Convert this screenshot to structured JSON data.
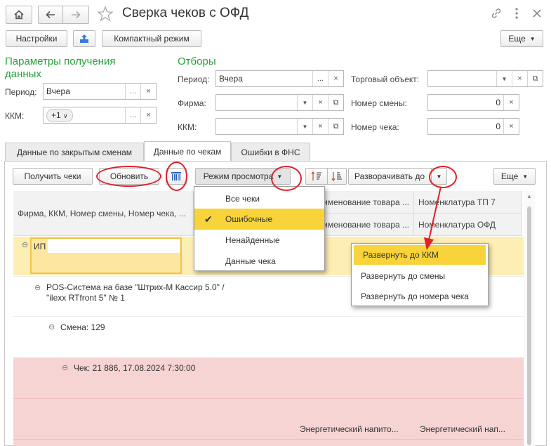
{
  "window": {
    "title": "Сверка чеков с ОФД",
    "home_icon": "home-icon",
    "back_icon": "arrow-left-icon",
    "forward_icon": "arrow-right-icon",
    "star_icon": "star-icon",
    "link_icon": "link-icon",
    "more_icon": "kebab-icon",
    "close_icon": "close-icon"
  },
  "toolbar": {
    "settings": "Настройки",
    "upload_icon": "upload-icon",
    "compact": "Компактный режим",
    "more": "Еще"
  },
  "params": {
    "heading_line1": "Параметры получения",
    "heading_line2": "данных",
    "period_label": "Период:",
    "period_value": "Вчера",
    "kkm_label": "ККМ:",
    "kkm_value": "+1"
  },
  "filters": {
    "heading": "Отборы",
    "period_label": "Период:",
    "period_value": "Вчера",
    "firm_label": "Фирма:",
    "firm_value": "",
    "kkm_label": "ККМ:",
    "kkm_value": "",
    "trade_object_label": "Торговый объект:",
    "trade_object_value": "",
    "shift_number_label": "Номер смены:",
    "shift_number_value": "0",
    "check_number_label": "Номер чека:",
    "check_number_value": "0"
  },
  "tabs": [
    {
      "label": "Данные по закрытым сменам",
      "active": false
    },
    {
      "label": "Данные по чекам",
      "active": true
    },
    {
      "label": "Ошибки в ФНС",
      "active": false
    }
  ],
  "panel_toolbar": {
    "get_checks": "Получить чеки",
    "refresh": "Обновить",
    "barcode_icon": "barcode-icon",
    "view_mode": "Режим просмотра",
    "sort_asc_icon": "sort-ascending-icon",
    "sort_desc_icon": "sort-descending-icon",
    "expand_to": "Разворачивать до",
    "more": "Еще"
  },
  "table": {
    "headers": {
      "col1": "Фирма, ККМ, Номер смены, Номер чека, ...",
      "col2_row1": "Наименование товара ...",
      "col2_row2": "Наименование товара ...",
      "col3_row1": "Номенклатура ТП 7",
      "col3_row2": "Номенклатура ОФД"
    },
    "rows": {
      "firm": "ИП",
      "kkm_line1": "POS-Система на базе \"Штрих-М Кассир 5.0\" /",
      "kkm_line2": "\"ilexx RTfront 5\" № 1",
      "shift": "Смена: 129",
      "check": "Чек: 21 886, 17.08.2024 7:30:00",
      "goods_col2": "Энергетический напито...",
      "goods_col3": "Энергетический нап..."
    }
  },
  "view_mode_menu": {
    "items": [
      {
        "label": "Все чеки",
        "checked": false,
        "selected": false
      },
      {
        "label": "Ошибочные",
        "checked": true,
        "selected": true
      },
      {
        "label": "Ненайденные",
        "checked": false,
        "selected": false
      },
      {
        "label": "Данные чека",
        "checked": false,
        "selected": false
      }
    ]
  },
  "expand_menu": {
    "items": [
      {
        "label": "Развернуть до ККМ",
        "selected": true
      },
      {
        "label": "Развернуть до смены",
        "selected": false
      },
      {
        "label": "Развернуть до номера чека",
        "selected": false
      }
    ]
  },
  "colors": {
    "accent_green": "#2a9e3b",
    "highlight_yellow": "#f9d33a",
    "row_yellow": "#fdeeb3",
    "row_pink": "#f6d4d4",
    "annotation_red": "#e0202a"
  }
}
